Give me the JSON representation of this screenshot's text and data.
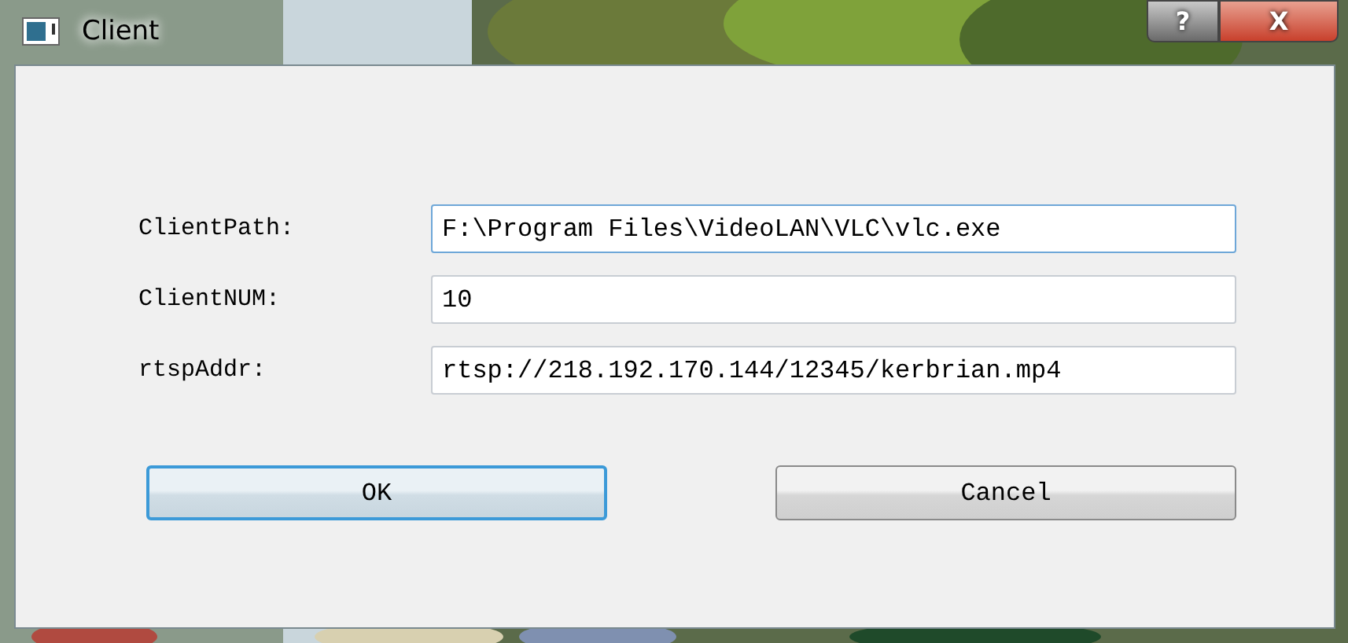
{
  "window": {
    "title": "Client",
    "caption_buttons": [
      {
        "kind": "help",
        "label": "?"
      },
      {
        "kind": "close",
        "label": "X"
      }
    ]
  },
  "fields": [
    {
      "label": "ClientPath:",
      "value": "F:\\Program Files\\VideoLAN\\VLC\\vlc.exe",
      "focused": true
    },
    {
      "label": "ClientNUM:",
      "value": "10",
      "focused": false
    },
    {
      "label": "rtspAddr:",
      "value": "rtsp://218.192.170.144/12345/kerbrian.mp4",
      "focused": false
    }
  ],
  "buttons": [
    {
      "label": "OK",
      "default": true
    },
    {
      "label": "Cancel",
      "default": false
    }
  ]
}
